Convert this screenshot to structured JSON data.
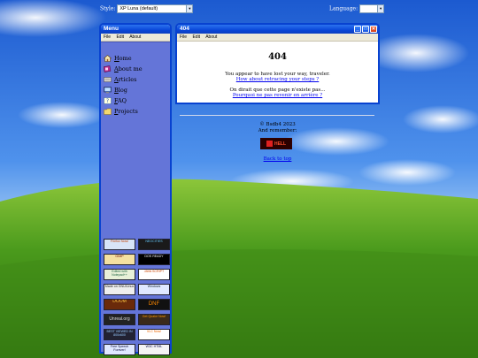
{
  "style_switch": {
    "label": "Style:",
    "value": "XP Luna (default)"
  },
  "language_switch": {
    "label": "Language:",
    "value": ""
  },
  "menu_window": {
    "title": "Menu",
    "menubar": [
      "File",
      "Edit",
      "About"
    ],
    "items": [
      {
        "label": "Home",
        "icon": "home-icon"
      },
      {
        "label": "About me",
        "icon": "about-icon"
      },
      {
        "label": "Articles",
        "icon": "articles-icon"
      },
      {
        "label": "Blog",
        "icon": "blog-icon"
      },
      {
        "label": "FAQ",
        "icon": "faq-icon"
      },
      {
        "label": "Projects",
        "icon": "projects-icon"
      }
    ],
    "badges": [
      {
        "name": "firefox-badge",
        "text": "Firefox Now!"
      },
      {
        "name": "neocities-badge",
        "text": "NEOCITIES"
      },
      {
        "name": "gimp-badge",
        "text": "GIMP"
      },
      {
        "name": "dos-badge",
        "text": "DOS READY"
      },
      {
        "name": "edited-badge",
        "text": "Edited with Notepad++"
      },
      {
        "name": "java-badge",
        "text": "JAVA SCRIPT"
      },
      {
        "name": "linux-badge",
        "text": "Made on GNU/Linux"
      },
      {
        "name": "windows-badge",
        "text": "Windows"
      },
      {
        "name": "doom-badge",
        "text": "DOOM"
      },
      {
        "name": "dnf-badge",
        "text": "DNF"
      },
      {
        "name": "unreal-badge",
        "text": "Unreal.org"
      },
      {
        "name": "quake-badge",
        "text": "Get Quake Now!"
      },
      {
        "name": "resolution-badge",
        "text": "BEST VIEWED IN 800x600"
      },
      {
        "name": "vlc-badge",
        "text": "VLC Now!"
      },
      {
        "name": "freespeech-badge",
        "text": "Free Speech Forever!"
      },
      {
        "name": "w3-badge",
        "text": "W3C HTML"
      }
    ]
  },
  "main_window": {
    "title": "404",
    "menubar": [
      "File",
      "Edit",
      "About"
    ],
    "heading": "404",
    "line1": "You appear to have lost your way, traveler.",
    "link1": "How about retracing your steps ?",
    "line2": "On dirait que cette page n'existe pas...",
    "link2": "Pourquoi ne pas revenir en arrière ?",
    "buttons": {
      "minimize": "_",
      "maximize": "□",
      "close": "✕"
    }
  },
  "footer": {
    "copyright": "© Bsdb4 2023",
    "remember": "And remember:",
    "badge_text": "HELL",
    "back_to_top": "Back to top"
  },
  "colors": {
    "titlebar": "#0a47d8",
    "menu_panel": "#6475d8",
    "link": "#0000ee"
  }
}
